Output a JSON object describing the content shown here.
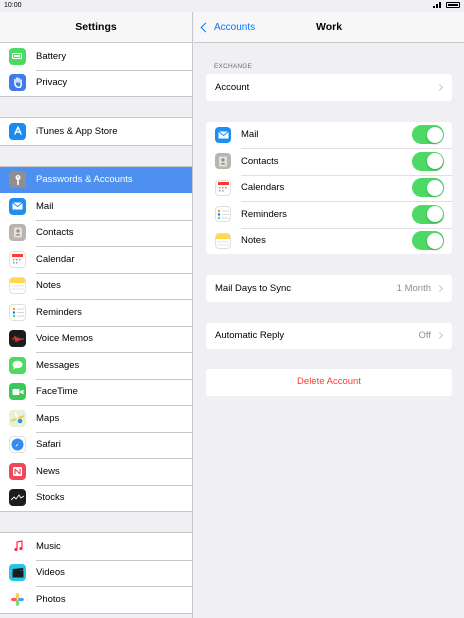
{
  "status_bar": {
    "time": "10:00"
  },
  "sidebar": {
    "title": "Settings",
    "groups": [
      [
        {
          "label": "Battery",
          "icon": "battery-icon",
          "color": "#4cd964"
        },
        {
          "label": "Privacy",
          "icon": "hand-icon",
          "color": "#3f7ce8"
        }
      ],
      [
        {
          "label": "iTunes & App Store",
          "icon": "app-store-icon",
          "color": "#1a8cf0"
        }
      ],
      [
        {
          "label": "Passwords & Accounts",
          "icon": "key-icon",
          "color": "#8e8e93",
          "selected": true
        },
        {
          "label": "Mail",
          "icon": "mail-icon",
          "color": "#1f8ef1"
        },
        {
          "label": "Contacts",
          "icon": "contacts-icon",
          "color": "#b9b4ad"
        },
        {
          "label": "Calendar",
          "icon": "calendar-icon",
          "color": "#ffffff"
        },
        {
          "label": "Notes",
          "icon": "notes-icon",
          "color": "#ffd84d"
        },
        {
          "label": "Reminders",
          "icon": "reminders-icon",
          "color": "#ffffff"
        },
        {
          "label": "Voice Memos",
          "icon": "voice-memos-icon",
          "color": "#1c1c1e"
        },
        {
          "label": "Messages",
          "icon": "messages-icon",
          "color": "#4cd964"
        },
        {
          "label": "FaceTime",
          "icon": "facetime-icon",
          "color": "#3cc75a"
        },
        {
          "label": "Maps",
          "icon": "maps-icon",
          "color": "#e5f1d8"
        },
        {
          "label": "Safari",
          "icon": "safari-icon",
          "color": "#2d8ff1"
        },
        {
          "label": "News",
          "icon": "news-icon",
          "color": "#f0485a"
        },
        {
          "label": "Stocks",
          "icon": "stocks-icon",
          "color": "#1c1c1e"
        }
      ],
      [
        {
          "label": "Music",
          "icon": "music-icon",
          "color": "#ffffff"
        },
        {
          "label": "Videos",
          "icon": "videos-icon",
          "color": "#27c6e3"
        },
        {
          "label": "Photos",
          "icon": "photos-icon",
          "color": "#ffffff"
        }
      ]
    ]
  },
  "detail": {
    "back_label": "Accounts",
    "title": "Work",
    "section_label": "EXCHANGE",
    "account_label": "Account",
    "sync_items": [
      {
        "label": "Mail",
        "icon": "mail-icon",
        "color": "#1f8ef1",
        "on": true
      },
      {
        "label": "Contacts",
        "icon": "contacts-icon",
        "color": "#b9b4ad",
        "on": true
      },
      {
        "label": "Calendars",
        "icon": "calendar-icon",
        "color": "#ffffff",
        "on": true
      },
      {
        "label": "Reminders",
        "icon": "reminders-icon",
        "color": "#ffffff",
        "on": true
      },
      {
        "label": "Notes",
        "icon": "notes-icon",
        "color": "#ffd84d",
        "on": true
      }
    ],
    "mail_days_label": "Mail Days to Sync",
    "mail_days_value": "1 Month",
    "auto_reply_label": "Automatic Reply",
    "auto_reply_value": "Off",
    "delete_label": "Delete Account"
  },
  "colors": {
    "accent": "#007aff",
    "toggle_on": "#4cd964",
    "destructive": "#ff3b30",
    "selected_row": "#4d90f0"
  }
}
